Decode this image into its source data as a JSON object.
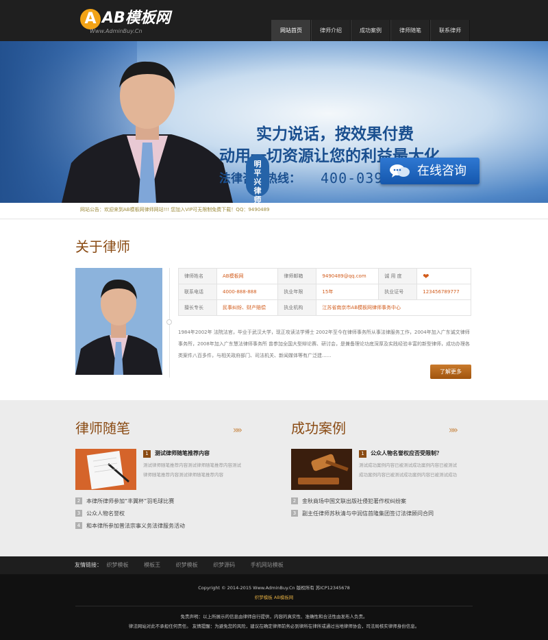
{
  "logo": {
    "badge": "A",
    "text": "AB模板网",
    "sub": "Www.AdminBuy.Cn"
  },
  "nav": [
    "网站首页",
    "律师介绍",
    "成功案例",
    "律师随笔",
    "联系律师"
  ],
  "banner": {
    "line1": "实力说话，按效果付费",
    "line2": "动用一切资源让您的利益最大化",
    "hotline_label": "法律咨询热线：",
    "hotline": "400-039-8892",
    "seal": "明平兴律师",
    "consult": "在线咨询",
    "colors": {
      "brand_blue": "#1a4f8f",
      "button_blue": "#1e64bf"
    }
  },
  "notice": "网站公告：欢迎来到AB模板网律师网站!!!  您加入VIP可无限制免费下载！QQ：9490489",
  "about": {
    "title": "关于律师",
    "table": [
      [
        {
          "k": "律师姓名",
          "v": "AB模板网"
        },
        {
          "k": "律师邮箱",
          "v": "9490489@qq.com"
        },
        {
          "k": "诚 用 度",
          "v": "❤"
        }
      ],
      [
        {
          "k": "联系电话",
          "v": "4000-888-888"
        },
        {
          "k": "执业年限",
          "v": "15年"
        },
        {
          "k": "执业证号",
          "v": "123456789777"
        }
      ],
      [
        {
          "k": "擅长专长",
          "v": "民事纠纷、财产赔偿"
        },
        {
          "k": "执业机构",
          "v": "江苏省南京市AB模板网律师事务中心"
        }
      ]
    ],
    "desc": "1984年2002年 法院法官，毕业于武汉大学，现正攻读法学博士 2002年至今在律师事务所从事法律服务工作，2004年加入广东诚文律师事务所，2008年加入广东慧法律师事务所 曾参加全国大型辩论赛、研讨会，是兼备理论功底深厚及实践经验丰富的新型律师，成功办理各类案件八百多件，与相关政府部门、司法机关、新闻媒体等有广泛建......",
    "more": "了解更多"
  },
  "essays": {
    "title": "律师随笔",
    "arrows": "»»",
    "featured": {
      "num": "1",
      "title": "测试律师随笔推荐内容",
      "desc": "测试律师随笔推荐内容测试律师随笔推荐内容测试律师随笔推荐内容测试律师随笔推荐内容"
    },
    "items": [
      {
        "num": "2",
        "text": "本律所律师参加“丰翼杯”羽毛球比赛"
      },
      {
        "num": "3",
        "text": "公众人物名誉权"
      },
      {
        "num": "4",
        "text": "和本律所参加普法宗事义务法律服务活动"
      }
    ]
  },
  "cases": {
    "title": "成功案例",
    "arrows": "»»",
    "featured": {
      "num": "1",
      "title": "公众人物名誉权应否受限制？",
      "desc": "测试成功案例内容已被测试成功案例内容已被测试成功案例内容已被测试成功案例内容已被测试成功"
    },
    "items": [
      {
        "num": "2",
        "text": "金秋商场中国文联出版社侵犯著作权纠纷案"
      },
      {
        "num": "3",
        "text": "副主任律师苏秋清与中润信首隆集团签订法律顾问合同"
      }
    ]
  },
  "friend_links": {
    "label": "友情链接：",
    "links": [
      "织梦模板",
      "模板王",
      "织梦模板",
      "织梦源码",
      "手机网站模板"
    ]
  },
  "footer": {
    "copyright": "Copyright © 2014-2015 Www.AdminBuy.Cn 版权所有  苏ICP12345678",
    "links": "织梦模板   AB模板网",
    "disclaimer": "免责声明：以上所展示的信息由律师自行提供，内容的真实性、准确性和合法性由发布人负责。",
    "disclaimer2": "律法网站对此不承担任何责任。  友情提醒：为避免您的风险，建议在确定律师前务必到律所在律所或通过当地律师协会，司法局核实律师身份信息。"
  }
}
